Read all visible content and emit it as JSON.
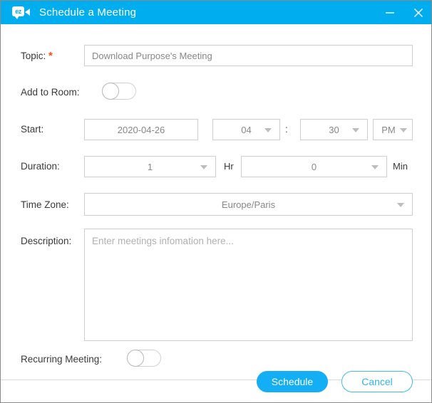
{
  "window": {
    "title": "Schedule a Meeting",
    "app_icon": "ez-video-icon",
    "accent_color": "#00ADEF",
    "controls": {
      "minimize": "minimize-icon",
      "close": "close-icon"
    }
  },
  "form": {
    "topic": {
      "label": "Topic:",
      "required_marker": "*",
      "value": "Download Purpose's Meeting"
    },
    "add_to_room": {
      "label": "Add to Room:",
      "state": "off"
    },
    "start": {
      "label": "Start:",
      "date": "2020-04-26",
      "hour": "04",
      "separator": ":",
      "minute": "30",
      "meridiem": "PM"
    },
    "duration": {
      "label": "Duration:",
      "hours_value": "1",
      "hours_unit": "Hr",
      "minutes_value": "0",
      "minutes_unit": "Min"
    },
    "time_zone": {
      "label": "Time Zone:",
      "value": "Europe/Paris"
    },
    "description": {
      "label": "Description:",
      "value": "",
      "placeholder": "Enter meetings infomation here..."
    },
    "recurring": {
      "label": "Recurring Meeting:",
      "state": "off"
    }
  },
  "footer": {
    "schedule_label": "Schedule",
    "cancel_label": "Cancel"
  }
}
